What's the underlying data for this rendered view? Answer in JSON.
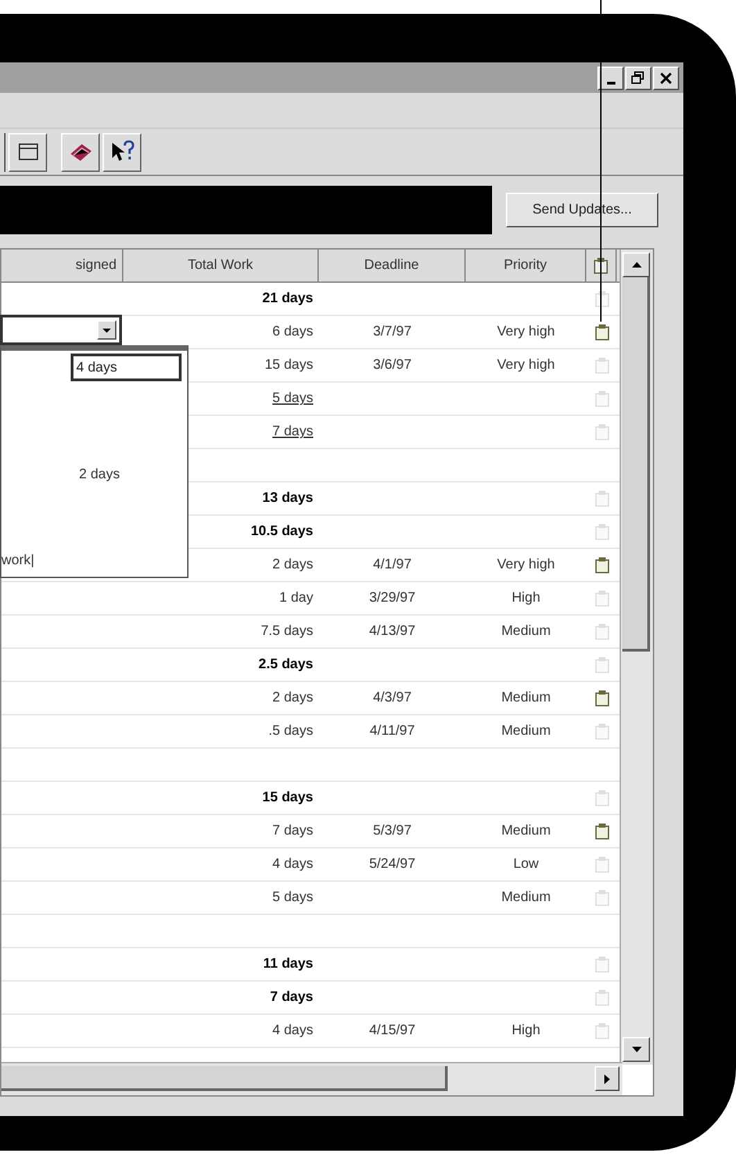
{
  "send_updates_button": "Send Updates...",
  "table": {
    "columns": [
      "signed",
      "Total Work",
      "Deadline",
      "Priority"
    ],
    "rows": [
      {
        "kind": "summary",
        "total_work": "21 days",
        "note": false
      },
      {
        "kind": "task",
        "total_work": "6 days",
        "deadline": "3/7/97",
        "priority": "Very high",
        "note": true,
        "linked": false
      },
      {
        "kind": "task",
        "total_work": "15 days",
        "deadline": "3/6/97",
        "priority": "Very high",
        "note": false,
        "linked": false
      },
      {
        "kind": "task",
        "total_work": "5 days",
        "note": false,
        "linked": true
      },
      {
        "kind": "task",
        "total_work": "7 days",
        "note": false,
        "linked": true
      },
      {
        "kind": "blank"
      },
      {
        "kind": "summary",
        "total_work": "13 days",
        "note": false
      },
      {
        "kind": "summary",
        "total_work": "10.5 days",
        "note": false
      },
      {
        "kind": "task",
        "total_work": "2 days",
        "deadline": "4/1/97",
        "priority": "Very high",
        "note": true,
        "linked": false
      },
      {
        "kind": "task",
        "total_work": "1 day",
        "deadline": "3/29/97",
        "priority": "High",
        "note": false,
        "linked": false
      },
      {
        "kind": "task",
        "total_work": "7.5 days",
        "deadline": "4/13/97",
        "priority": "Medium",
        "note": false,
        "linked": false
      },
      {
        "kind": "summary",
        "total_work": "2.5 days",
        "note": false
      },
      {
        "kind": "task",
        "total_work": "2 days",
        "deadline": "4/3/97",
        "priority": "Medium",
        "note": true,
        "linked": false
      },
      {
        "kind": "task",
        "total_work": ".5 days",
        "deadline": "4/11/97",
        "priority": "Medium",
        "note": false,
        "linked": false
      },
      {
        "kind": "blank"
      },
      {
        "kind": "summary",
        "total_work": "15 days",
        "note": false
      },
      {
        "kind": "task",
        "total_work": "7 days",
        "deadline": "5/3/97",
        "priority": "Medium",
        "note": true,
        "linked": false
      },
      {
        "kind": "task",
        "total_work": "4 days",
        "deadline": "5/24/97",
        "priority": "Low",
        "note": false,
        "linked": false
      },
      {
        "kind": "task",
        "total_work": "5 days",
        "priority": "Medium",
        "note": false,
        "linked": false
      },
      {
        "kind": "blank"
      },
      {
        "kind": "summary",
        "total_work": "11 days",
        "note": false
      },
      {
        "kind": "summary",
        "total_work": "7 days",
        "note": false
      },
      {
        "kind": "task",
        "total_work": "4 days",
        "deadline": "4/15/97",
        "priority": "High",
        "note": false,
        "linked": false
      }
    ]
  },
  "dropdown": {
    "value": "4 days",
    "items": [
      "2 days",
      "work|"
    ]
  }
}
